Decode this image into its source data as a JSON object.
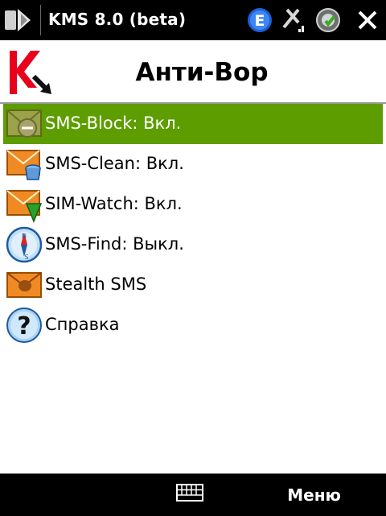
{
  "status_bar": {
    "title": "KMS 8.0 (beta)",
    "icons": [
      "start-flag-icon",
      "e-connection-icon",
      "antenna-signal-icon",
      "volume-icon",
      "close-icon"
    ]
  },
  "header": {
    "title": "Анти-Вор",
    "logo": "kaspersky-logo-icon"
  },
  "menu_items": [
    {
      "label": "SMS-Block: Вкл.",
      "icon": "sms-block-icon",
      "selected": true
    },
    {
      "label": "SMS-Clean: Вкл.",
      "icon": "sms-clean-icon",
      "selected": false
    },
    {
      "label": "SIM-Watch: Вкл.",
      "icon": "sim-watch-icon",
      "selected": false
    },
    {
      "label": "SMS-Find: Выкл.",
      "icon": "compass-icon",
      "selected": false
    },
    {
      "label": "Stealth SMS",
      "icon": "stealth-sms-icon",
      "selected": false
    },
    {
      "label": "Справка",
      "icon": "help-icon",
      "selected": false
    }
  ],
  "softkeys": {
    "right_label": "Меню",
    "keyboard_icon": "keyboard-icon"
  },
  "colors": {
    "selection": "#5d9d00",
    "envelope": "#f08a24",
    "brand_red": "#e8001c"
  }
}
